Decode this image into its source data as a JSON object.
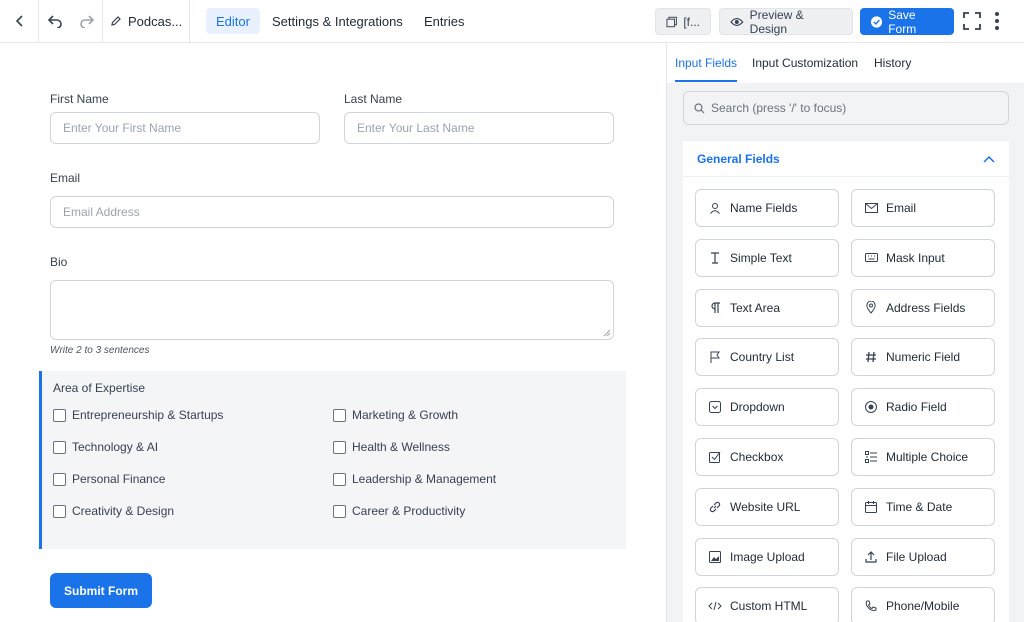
{
  "topbar": {
    "form_title": "Podcas...",
    "tabs": [
      "Editor",
      "Settings & Integrations",
      "Entries"
    ],
    "shortcode_label": "[f...",
    "preview_label": "Preview & Design",
    "save_label": "Save Form"
  },
  "form": {
    "first_name": {
      "label": "First Name",
      "placeholder": "Enter Your First Name"
    },
    "last_name": {
      "label": "Last Name",
      "placeholder": "Enter Your Last Name"
    },
    "email": {
      "label": "Email",
      "placeholder": "Email Address"
    },
    "bio": {
      "label": "Bio",
      "help": "Write 2 to 3 sentences"
    },
    "expertise": {
      "label": "Area of Expertise",
      "options": [
        "Entrepreneurship & Startups",
        "Marketing & Growth",
        "Technology & AI",
        "Health & Wellness",
        "Personal Finance",
        "Leadership & Management",
        "Creativity & Design",
        "Career & Productivity"
      ]
    },
    "submit_label": "Submit Form"
  },
  "panel": {
    "tabs": [
      "Input Fields",
      "Input Customization",
      "History"
    ],
    "search_placeholder": "Search (press '/' to focus)",
    "section_title": "General Fields",
    "fields": [
      {
        "label": "Name Fields",
        "icon": "user-icon"
      },
      {
        "label": "Email",
        "icon": "envelope-icon"
      },
      {
        "label": "Simple Text",
        "icon": "text-cursor-icon"
      },
      {
        "label": "Mask Input",
        "icon": "keyboard-icon"
      },
      {
        "label": "Text Area",
        "icon": "paragraph-icon"
      },
      {
        "label": "Address Fields",
        "icon": "map-pin-icon"
      },
      {
        "label": "Country List",
        "icon": "flag-icon"
      },
      {
        "label": "Numeric Field",
        "icon": "hash-icon"
      },
      {
        "label": "Dropdown",
        "icon": "dropdown-icon"
      },
      {
        "label": "Radio Field",
        "icon": "radio-icon"
      },
      {
        "label": "Checkbox",
        "icon": "checkbox-icon"
      },
      {
        "label": "Multiple Choice",
        "icon": "list-icon"
      },
      {
        "label": "Website URL",
        "icon": "link-icon"
      },
      {
        "label": "Time & Date",
        "icon": "calendar-icon"
      },
      {
        "label": "Image Upload",
        "icon": "image-icon"
      },
      {
        "label": "File Upload",
        "icon": "upload-icon"
      },
      {
        "label": "Custom HTML",
        "icon": "code-icon"
      },
      {
        "label": "Phone/Mobile",
        "icon": "phone-icon"
      }
    ]
  }
}
